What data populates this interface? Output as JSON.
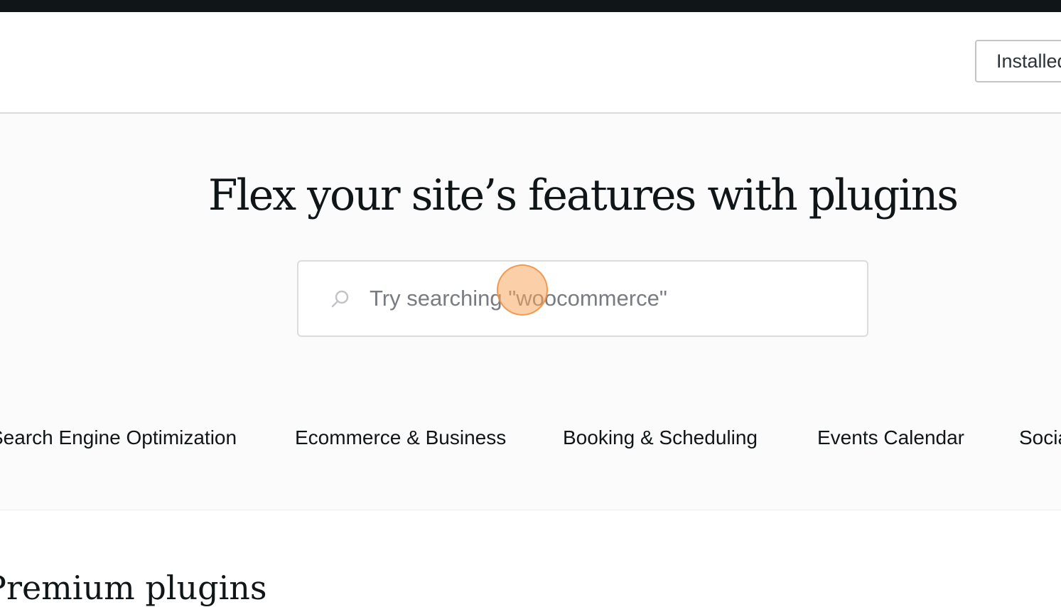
{
  "header": {
    "installed_label": "Installed Plugins"
  },
  "hero": {
    "title": "Flex your site’s features with plugins",
    "search": {
      "placeholder": "Try searching \"woocommerce\"",
      "icon": "search-icon"
    }
  },
  "categories": [
    {
      "label": "Search Engine Optimization"
    },
    {
      "label": "Ecommerce & Business"
    },
    {
      "label": "Booking & Scheduling"
    },
    {
      "label": "Events Calendar"
    },
    {
      "label": "Social"
    }
  ],
  "sections": {
    "premium_title": "Premium plugins"
  },
  "colors": {
    "top_bar": "#101517",
    "text": "#101517",
    "cursor_highlight": "#f8a860"
  }
}
